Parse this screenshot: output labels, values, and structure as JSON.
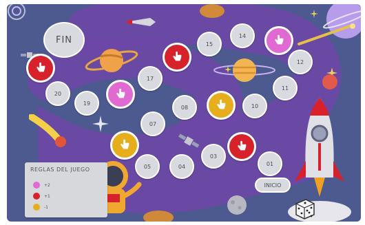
{
  "board": {
    "finish_label": "FIN",
    "start_label": "INICIO",
    "cells": [
      {
        "id": "cell-01",
        "label": "01",
        "type": "normal"
      },
      {
        "id": "cell-02",
        "label": "",
        "type": "red"
      },
      {
        "id": "cell-03",
        "label": "03",
        "type": "normal"
      },
      {
        "id": "cell-04",
        "label": "04",
        "type": "normal"
      },
      {
        "id": "cell-05",
        "label": "05",
        "type": "normal"
      },
      {
        "id": "cell-06",
        "label": "",
        "type": "yellow"
      },
      {
        "id": "cell-07",
        "label": "07",
        "type": "normal"
      },
      {
        "id": "cell-08",
        "label": "08",
        "type": "normal"
      },
      {
        "id": "cell-09",
        "label": "",
        "type": "yellow"
      },
      {
        "id": "cell-10",
        "label": "10",
        "type": "normal"
      },
      {
        "id": "cell-11",
        "label": "11",
        "type": "normal"
      },
      {
        "id": "cell-12",
        "label": "12",
        "type": "normal"
      },
      {
        "id": "cell-13",
        "label": "",
        "type": "pink"
      },
      {
        "id": "cell-14",
        "label": "14",
        "type": "normal"
      },
      {
        "id": "cell-15",
        "label": "15",
        "type": "normal"
      },
      {
        "id": "cell-16",
        "label": "",
        "type": "red"
      },
      {
        "id": "cell-17",
        "label": "17",
        "type": "normal"
      },
      {
        "id": "cell-18",
        "label": "",
        "type": "pink"
      },
      {
        "id": "cell-19",
        "label": "19",
        "type": "normal"
      },
      {
        "id": "cell-20",
        "label": "20",
        "type": "normal"
      },
      {
        "id": "cell-21",
        "label": "",
        "type": "red"
      }
    ]
  },
  "legend": {
    "title": "REGLAS DEL JUEGO",
    "rules": [
      {
        "color": "#e06ad1",
        "text": "+2"
      },
      {
        "color": "#d7222b",
        "text": "+1"
      },
      {
        "color": "#e6ae1d",
        "text": "-1"
      }
    ]
  },
  "colors": {
    "background": "#4d5a8f",
    "path": "#6f47a8",
    "red": "#d7222b",
    "pink": "#e06ad1",
    "yellow": "#e6ae1d",
    "cell": "#d9dadf"
  },
  "icons": [
    "pointer-hand-icon",
    "rocket-icon",
    "planet-icon",
    "comet-icon",
    "satellite-icon",
    "astronaut-icon",
    "moon-icon",
    "dice-icon",
    "star-icon"
  ]
}
